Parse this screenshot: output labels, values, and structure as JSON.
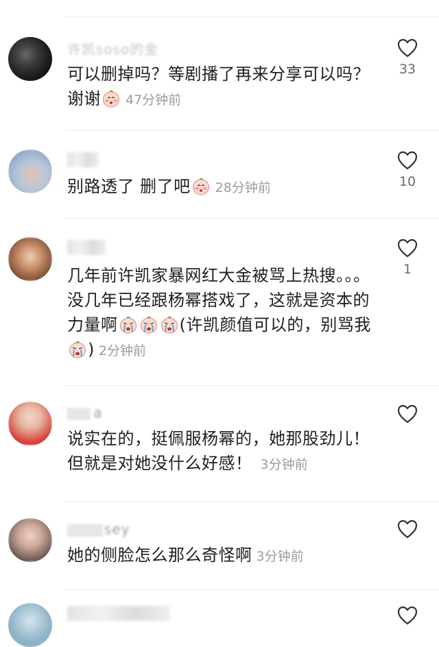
{
  "comments": [
    {
      "username": "许凯soso的金",
      "text": "可以删掉吗？等剧播了再来分享可以吗？谢谢",
      "time": "47分钟前",
      "likes": "33"
    },
    {
      "username": "",
      "text": "别路透了 删了吧",
      "time": "28分钟前",
      "likes": "10"
    },
    {
      "username": "",
      "text": "几年前许凯家暴网红大金被骂上热搜。。。没几年已经跟杨幂搭戏了，这就是资本的力量啊",
      "text_after": "(许凯颜值可以的，别骂我",
      "text_close": ")",
      "time": "2分钟前",
      "likes": "1"
    },
    {
      "username": "a",
      "text": "说实在的，挺佩服杨幂的，她那股劲儿！但就是对她没什么好感！",
      "time": "3分钟前",
      "likes": ""
    },
    {
      "username": "sey",
      "text": "她的侧脸怎么那么奇怪啊",
      "time": "3分钟前",
      "likes": ""
    }
  ],
  "icons": {
    "like": "heart-outline-icon",
    "emoji": "blushing-face-emoji-icon",
    "cry": "crying-face-emoji-icon"
  },
  "colors": {
    "text": "#1f1f1f",
    "time": "#9b9b9b",
    "divider": "#ececec"
  }
}
